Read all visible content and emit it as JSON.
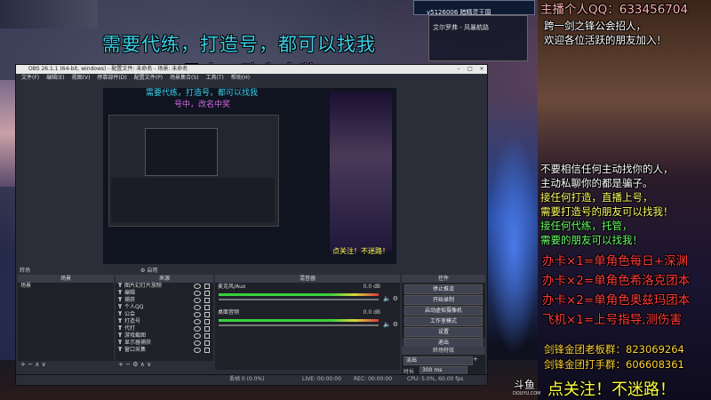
{
  "stream_overlay": {
    "banner_line1": "需要代练，打造号，都可以找我",
    "banner_line2": "号中，改名中奖",
    "top_right_title": "主播个人QQ：633456704",
    "top_right_lines": [
      "跨一剑之锋公会招人，",
      "欢迎各位活跃的朋友加入！"
    ],
    "right_notices": [
      {
        "text": "不要相信任何主动找你的人，",
        "color": "#ffffff"
      },
      {
        "text": "主动私聊你的都是骗子。",
        "color": "#ffffff"
      },
      {
        "text": "接任何打造，直播上号，",
        "color": "#ffff66"
      },
      {
        "text": "需要打造号的朋友可以找我！",
        "color": "#ffff66"
      },
      {
        "text": "接任何代练，托管，",
        "color": "#66ff66"
      },
      {
        "text": "需要的朋友可以找我！",
        "color": "#66ff66"
      }
    ],
    "price_lines": [
      "办卡×1=单角色每日+深渊",
      "办卡×2=单角色希洛克团本",
      "办卡×2=单角色奥兹玛团本",
      "飞机×1=上号指导,测伤害"
    ],
    "group_lines": [
      "剑锋金团老板群：823069264",
      "剑锋金团打手群：606608361"
    ],
    "bottom_banner": "点关注！不迷路！",
    "watermark": "斗鱼",
    "watermark_sub": "DOUYU.COM",
    "game_window_title": "v5126006 暗精灵王国",
    "game_tag": "艾尔罗弗 - 风暴航路"
  },
  "obs": {
    "title": "OBS 26.1.1 (64-bit, windows) - 配置文件: 未命名 - 场景: 未命名",
    "menu": [
      "文件(F)",
      "编辑(E)",
      "视图(V)",
      "停靠部件(D)",
      "配置文件(P)",
      "场景集合(S)",
      "工具(T)",
      "帮助(H)"
    ],
    "transition_label": "转场",
    "transition_toggle": "启用",
    "scenes_header": "场景",
    "scenes_items": [
      "场景"
    ],
    "sources_header": "来源",
    "sources_items": [
      "图片幻灯片放映",
      "编辑",
      "捕获",
      "个人QQ",
      "公会",
      "打造号",
      "代打",
      "游戏截图",
      "显示器捕获",
      "窗口采集"
    ],
    "mixer_header": "混音器",
    "mixer_channels": [
      {
        "name": "桌面音频",
        "level": "0.0 dB"
      },
      {
        "name": "麦克风/Aux",
        "level": "0.0 dB"
      }
    ],
    "controls_header": "控件",
    "controls_buttons": [
      "停止推流",
      "开始录制",
      "启动虚拟摄像机",
      "工作室模式",
      "设置",
      "退出"
    ],
    "transitions_header": "转场特效",
    "transition_type": "淡出",
    "duration_label": "时长",
    "duration_value": "300 ms",
    "status": {
      "dropped": "丢帧 0 (0.0%)",
      "live": "LIVE: 00:00:00",
      "rec": "REC: 00:00:00",
      "cpu": "CPU: 5.0%, 60.00 fps",
      "kbps": "kb/s: 0"
    }
  },
  "colors": {
    "banner1": "#3ad0e8",
    "banner2": "#d36ae8",
    "obs_panel": "#2b2e38",
    "price_text": "#ff3b3b",
    "group_text": "#ffd23a"
  }
}
